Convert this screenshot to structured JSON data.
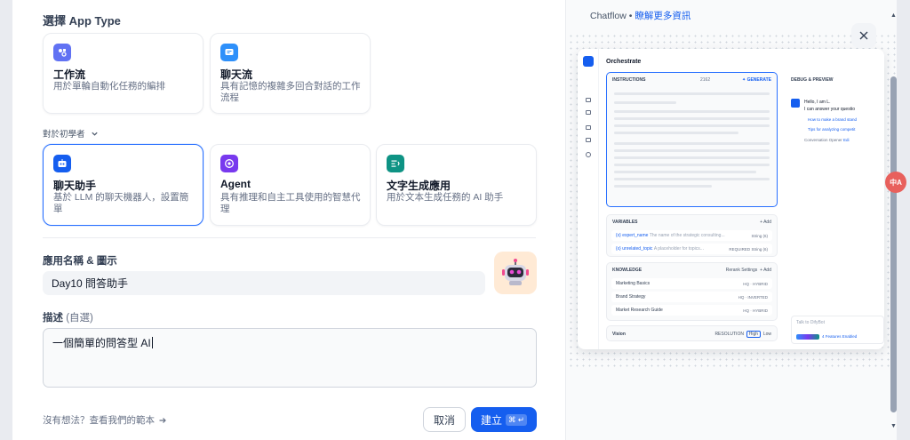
{
  "app_type": {
    "heading": "選擇 App Type",
    "cards_top": [
      {
        "title": "工作流",
        "desc": "用於單輪自動化任務的編排",
        "icon": "workflow-icon",
        "color": "#6172f3"
      },
      {
        "title": "聊天流",
        "desc": "具有記憶的複雜多回合對話的工作流程",
        "icon": "chatflow-icon",
        "color": "#2e90fa"
      }
    ],
    "beginner_toggle": "對於初學者",
    "cards_bottom": [
      {
        "title": "聊天助手",
        "desc": "基於 LLM 的聊天機器人，設置簡單",
        "icon": "chatbot-icon",
        "color": "#155eef",
        "selected": true
      },
      {
        "title": "Agent",
        "desc": "具有推理和自主工具使用的智慧代理",
        "icon": "agent-icon",
        "color": "#7839ee"
      },
      {
        "title": "文字生成應用",
        "desc": "用於文本生成任務的 AI 助手",
        "icon": "text-gen-icon",
        "color": "#0e9384"
      }
    ]
  },
  "form": {
    "name_label": "應用名稱 & 圖示",
    "name_value": "Day10 問答助手",
    "desc_label": "描述",
    "desc_optional": "(自選)",
    "desc_value": "一個簡單的問答型 AI"
  },
  "footer": {
    "template_link": "沒有想法？查看我們的範本",
    "cancel": "取消",
    "create": "建立",
    "create_shortcut": "⌘ ↵"
  },
  "preview": {
    "caption_prefix": "Chatflow •",
    "caption_link": "瞭解更多資訊",
    "orchestrate": "Orchestrate",
    "instructions": "INSTRUCTIONS",
    "char_count": "2162",
    "generate": "GENERATE",
    "variables": "VARIABLES",
    "add": "+ Add",
    "var_rows": [
      {
        "name": "{x} expert_name",
        "desc": "The name of the strategic consulting...",
        "type": "String (6)"
      },
      {
        "name": "{x} unrelated_topic",
        "desc": "A placeholder for topics...",
        "type": "String (6)",
        "req": "REQUIRED"
      }
    ],
    "knowledge": "KNOWLEDGE",
    "rerank": "Rerank Settings",
    "knowledge_rows": [
      {
        "name": "Marketing Basics",
        "tag": "HQ · HYBRID"
      },
      {
        "name": "Brand Strategy",
        "tag": "HQ · INVERTED"
      },
      {
        "name": "Market Research Guide",
        "tag": "HQ · HYBRID"
      }
    ],
    "vision": "Vision",
    "resolution": "RESOLUTION",
    "high": "High",
    "low": "Low",
    "debug": "DEBUG & PREVIEW",
    "greeting_1": "Hello, I am L.",
    "greeting_2": "I can answer your questio",
    "suggest_1": "How to make a brand stand",
    "suggest_2": "Tips for analyzing competit",
    "opener": "Conversation Opener",
    "opener_edit": "Edi",
    "talk": "Talk to DifyBot",
    "features": "4 Features Enabled"
  },
  "lang_badge": "中A"
}
